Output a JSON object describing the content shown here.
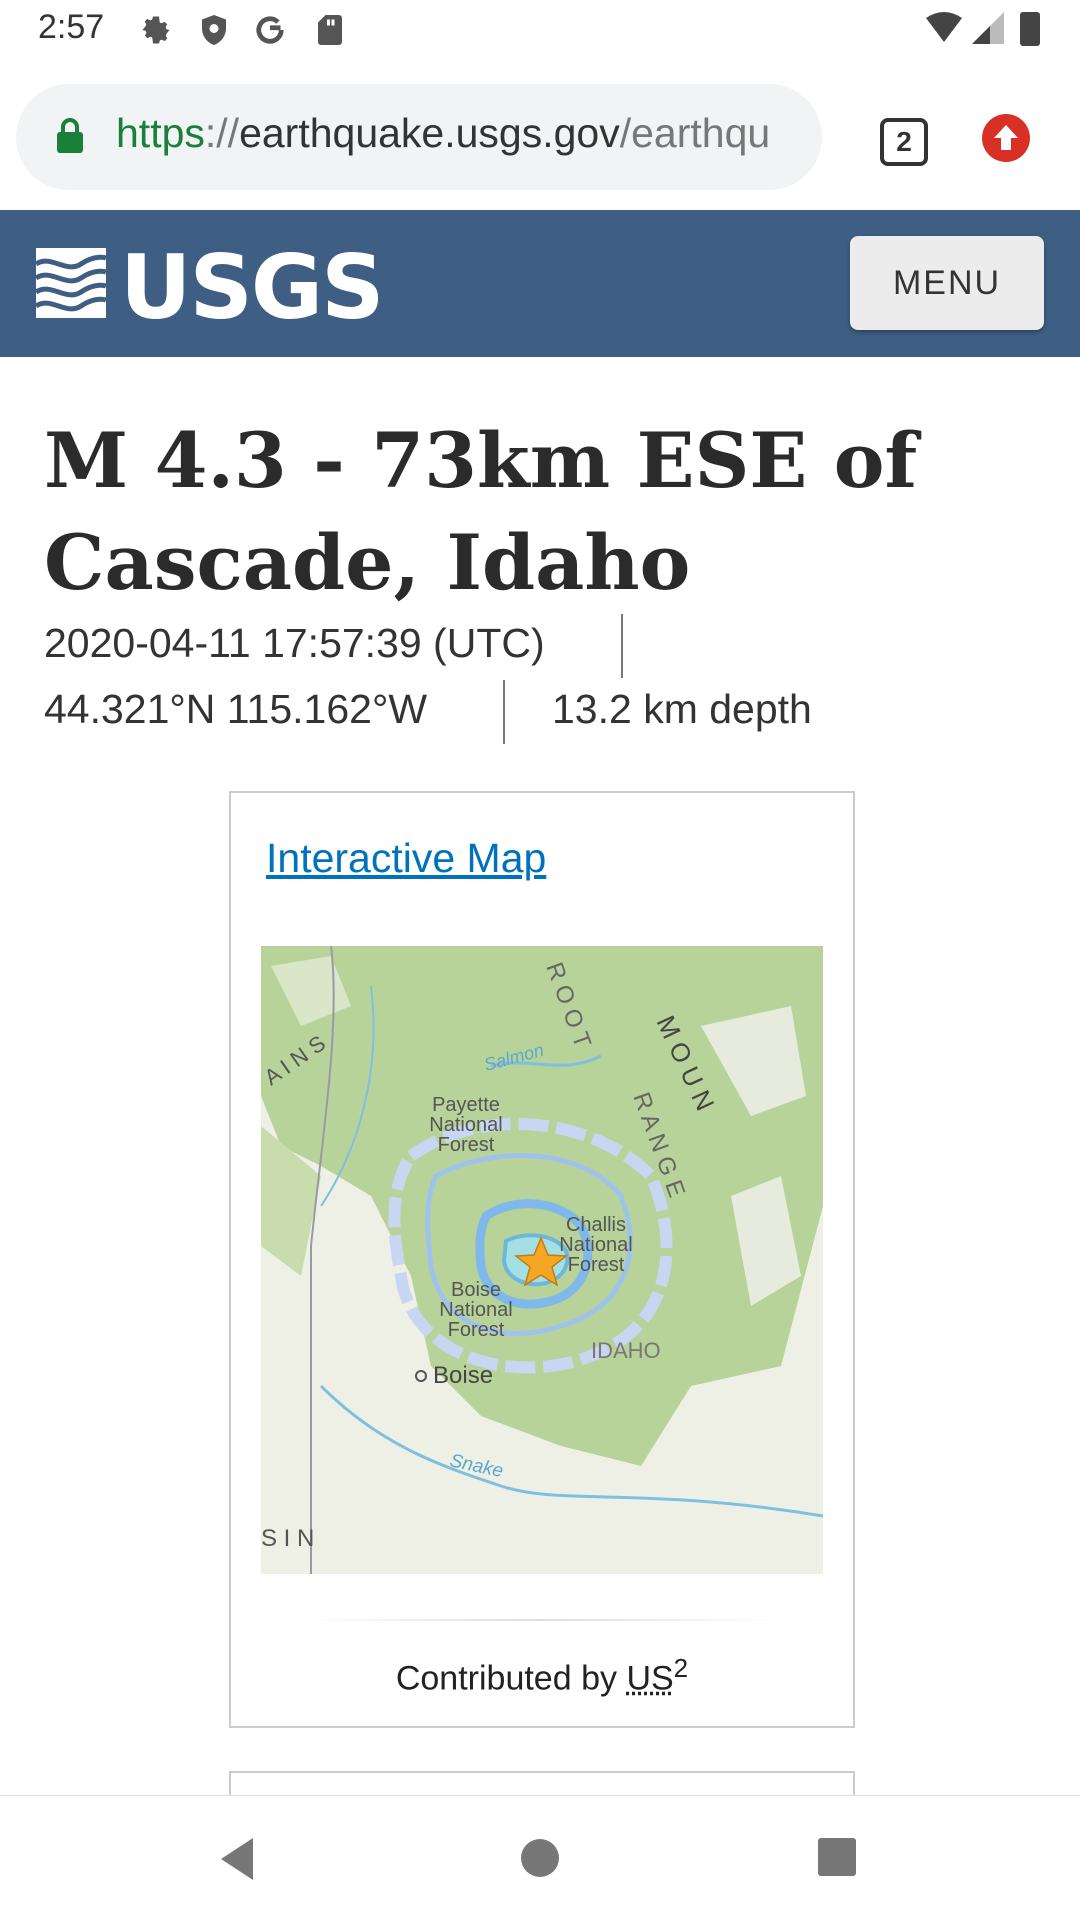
{
  "status_bar": {
    "time": "2:57",
    "icons": [
      "gear-icon",
      "shield-icon",
      "google-icon",
      "sd-card-icon"
    ],
    "right_icons": [
      "wifi-icon",
      "signal-icon",
      "battery-icon"
    ]
  },
  "browser": {
    "url_scheme": "https",
    "url_sep": "://",
    "url_host": "earthquake.usgs.gov",
    "url_path": "/earthqu",
    "tab_count": "2"
  },
  "site": {
    "logo_text": "USGS",
    "menu_label": "MENU"
  },
  "event": {
    "title": "M 4.3 - 73km ESE of Cascade, Idaho",
    "time": "2020-04-11 17:57:39 (UTC)",
    "coords": "44.321°N 115.162°W",
    "depth": "13.2 km depth"
  },
  "map_card": {
    "link_label": "Interactive Map",
    "contrib_prefix": "Contributed by ",
    "contrib_abbr": "US",
    "contrib_sup": "2",
    "labels": {
      "payette": "Payette\nNational\nForest",
      "challis": "Challis\nNational\nForest",
      "boise_nf": "Boise\nNational\nForest",
      "boise": "Boise",
      "idaho": "IDAHO",
      "salmon": "Salmon",
      "snake": "Snake",
      "sin": "S I N",
      "ains": "A I N S",
      "root": "R O O T",
      "range": "R A N G E",
      "moun": "M O U N"
    }
  },
  "colors": {
    "header": "#3e5f83",
    "link": "#0071bc",
    "map_land": "#e8ecdc",
    "map_forest": "#a9c98b",
    "intensity": "#7fb8ea",
    "star": "#f5a623"
  }
}
